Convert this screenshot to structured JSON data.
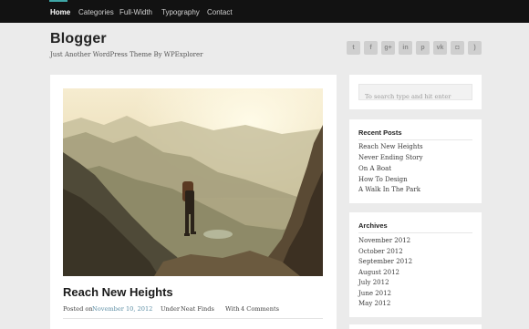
{
  "nav": {
    "items": [
      "Home",
      "Categories",
      "Full-Width",
      "Typography",
      "Contact"
    ],
    "active": "Home"
  },
  "header": {
    "title": "Blogger",
    "tagline": "Just Another WordPress Theme By WPExplorer"
  },
  "social": [
    {
      "icon": "twitter-icon",
      "glyph": "t"
    },
    {
      "icon": "facebook-icon",
      "glyph": "f"
    },
    {
      "icon": "google-plus-icon",
      "glyph": "g+"
    },
    {
      "icon": "linkedin-icon",
      "glyph": "in"
    },
    {
      "icon": "pinterest-icon",
      "glyph": "p"
    },
    {
      "icon": "vk-icon",
      "glyph": "vk"
    },
    {
      "icon": "instagram-icon",
      "glyph": "◘"
    },
    {
      "icon": "rss-icon",
      "glyph": ")"
    }
  ],
  "post": {
    "title": "Reach New Heights",
    "posted_label": "Posted on",
    "date": "November 10, 2012",
    "under_label": "Under",
    "category": "Neat Finds",
    "with_label": "With",
    "comments": "4 Comments"
  },
  "sidebar": {
    "search": {
      "placeholder": "To search type and hit enter"
    },
    "recent_posts": {
      "title": "Recent Posts",
      "items": [
        "Reach New Heights",
        "Never Ending Story",
        "On A Boat",
        "How To Design",
        "A Walk In The Park"
      ]
    },
    "archives": {
      "title": "Archives",
      "items": [
        "November 2012",
        "October 2012",
        "September 2012",
        "August 2012",
        "July 2012",
        "June 2012",
        "May 2012"
      ]
    }
  },
  "colors": {
    "nav_bg": "#121212",
    "accent": "#3ea6a6",
    "page_bg": "#ebebeb",
    "link": "#5e8fa5"
  }
}
